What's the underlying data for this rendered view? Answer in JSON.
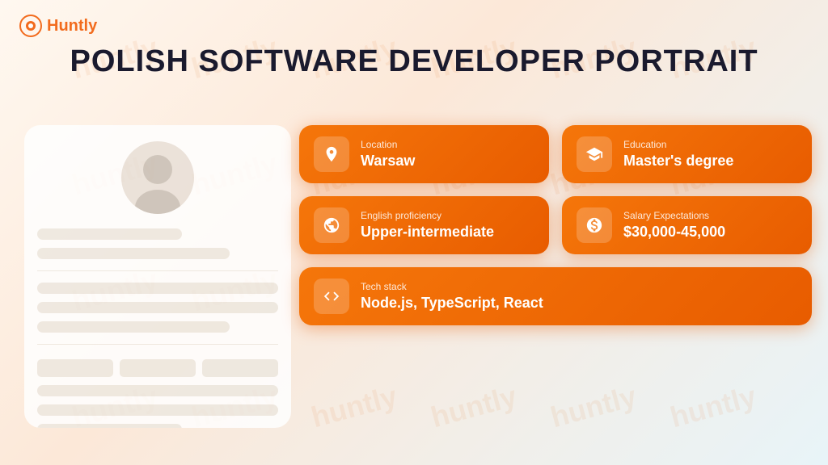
{
  "logo": {
    "text": "Huntly"
  },
  "title": "POLISH SOFTWARE DEVELOPER PORTRAIT",
  "cards": [
    {
      "id": "location",
      "label": "Location",
      "value": "Warsaw",
      "icon": "📍",
      "wide": false
    },
    {
      "id": "education",
      "label": "Education",
      "value": "Master's degree",
      "icon": "🎓",
      "wide": false
    },
    {
      "id": "english",
      "label": "English proficiency",
      "value": "Upper-intermediate",
      "icon": "🌐",
      "wide": false
    },
    {
      "id": "salary",
      "label": "Salary Expectations",
      "value": "$30,000-45,000",
      "icon": "💰",
      "wide": false
    },
    {
      "id": "techstack",
      "label": "Tech stack",
      "value": "Node.js, TypeScript, React",
      "icon": "💻",
      "wide": true
    }
  ],
  "watermark_text": "huntly"
}
